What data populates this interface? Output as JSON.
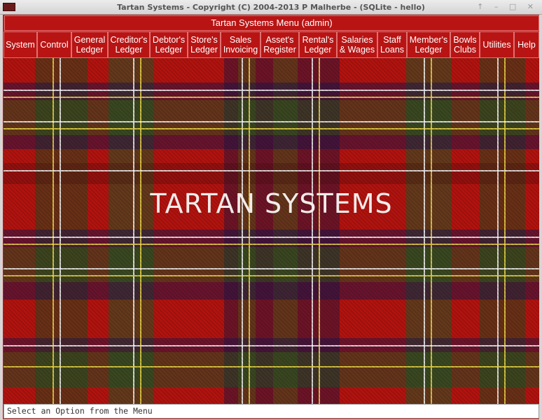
{
  "window": {
    "title": "Tartan Systems - Copyright (C) 2004-2013 P Malherbe - (SQLite - hello)",
    "controls": "↑ – □ ✕"
  },
  "menu": {
    "header": "Tartan Systems Menu (admin)",
    "items": [
      {
        "label": "System"
      },
      {
        "label": "Control"
      },
      {
        "label": "General\nLedger"
      },
      {
        "label": "Creditor's\nLedger"
      },
      {
        "label": "Debtor's\nLedger"
      },
      {
        "label": "Store's\nLedger"
      },
      {
        "label": "Sales\nInvoicing"
      },
      {
        "label": "Asset's\nRegister"
      },
      {
        "label": "Rental's\nLedger"
      },
      {
        "label": "Salaries\n& Wages"
      },
      {
        "label": "Staff\nLoans"
      },
      {
        "label": "Member's\nLedger"
      },
      {
        "label": "Bowls\nClubs"
      },
      {
        "label": "Utilities"
      },
      {
        "label": "Help"
      }
    ]
  },
  "main": {
    "brand": "TARTAN SYSTEMS"
  },
  "status": {
    "text": "Select an Option from the Menu"
  },
  "colors": {
    "menu_bg": "#b81414",
    "tartan_base": "#b3130f"
  }
}
